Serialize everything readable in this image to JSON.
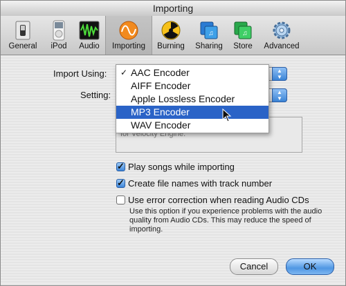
{
  "window": {
    "title": "Importing"
  },
  "toolbar": {
    "items": [
      {
        "label": "General",
        "icon": "switch-icon"
      },
      {
        "label": "iPod",
        "icon": "ipod-icon"
      },
      {
        "label": "Audio",
        "icon": "waveform-icon"
      },
      {
        "label": "Importing",
        "icon": "importing-icon",
        "selected": true
      },
      {
        "label": "Burning",
        "icon": "radiation-icon"
      },
      {
        "label": "Sharing",
        "icon": "sharing-icon"
      },
      {
        "label": "Store",
        "icon": "store-icon"
      },
      {
        "label": "Advanced",
        "icon": "gear-icon"
      }
    ]
  },
  "form": {
    "import_using_label": "Import Using:",
    "setting_label": "Setting:",
    "description_fragment": "for Velocity Engine.",
    "play_songs_label": "Play songs while importing",
    "play_songs_checked": true,
    "create_names_label": "Create file names with track number",
    "create_names_checked": true,
    "error_correction_label": "Use error correction when reading Audio CDs",
    "error_correction_checked": false,
    "error_help": "Use this option if you experience problems with the audio quality from Audio CDs. This may reduce the speed of importing."
  },
  "menu": {
    "items": [
      "AAC Encoder",
      "AIFF Encoder",
      "Apple Lossless Encoder",
      "MP3 Encoder",
      "WAV Encoder"
    ],
    "checked_index": 0,
    "highlighted_index": 3,
    "check_glyph": "✓"
  },
  "buttons": {
    "cancel": "Cancel",
    "ok": "OK"
  },
  "colors": {
    "highlight": "#2a63c7",
    "accent": "#3b84d6"
  }
}
